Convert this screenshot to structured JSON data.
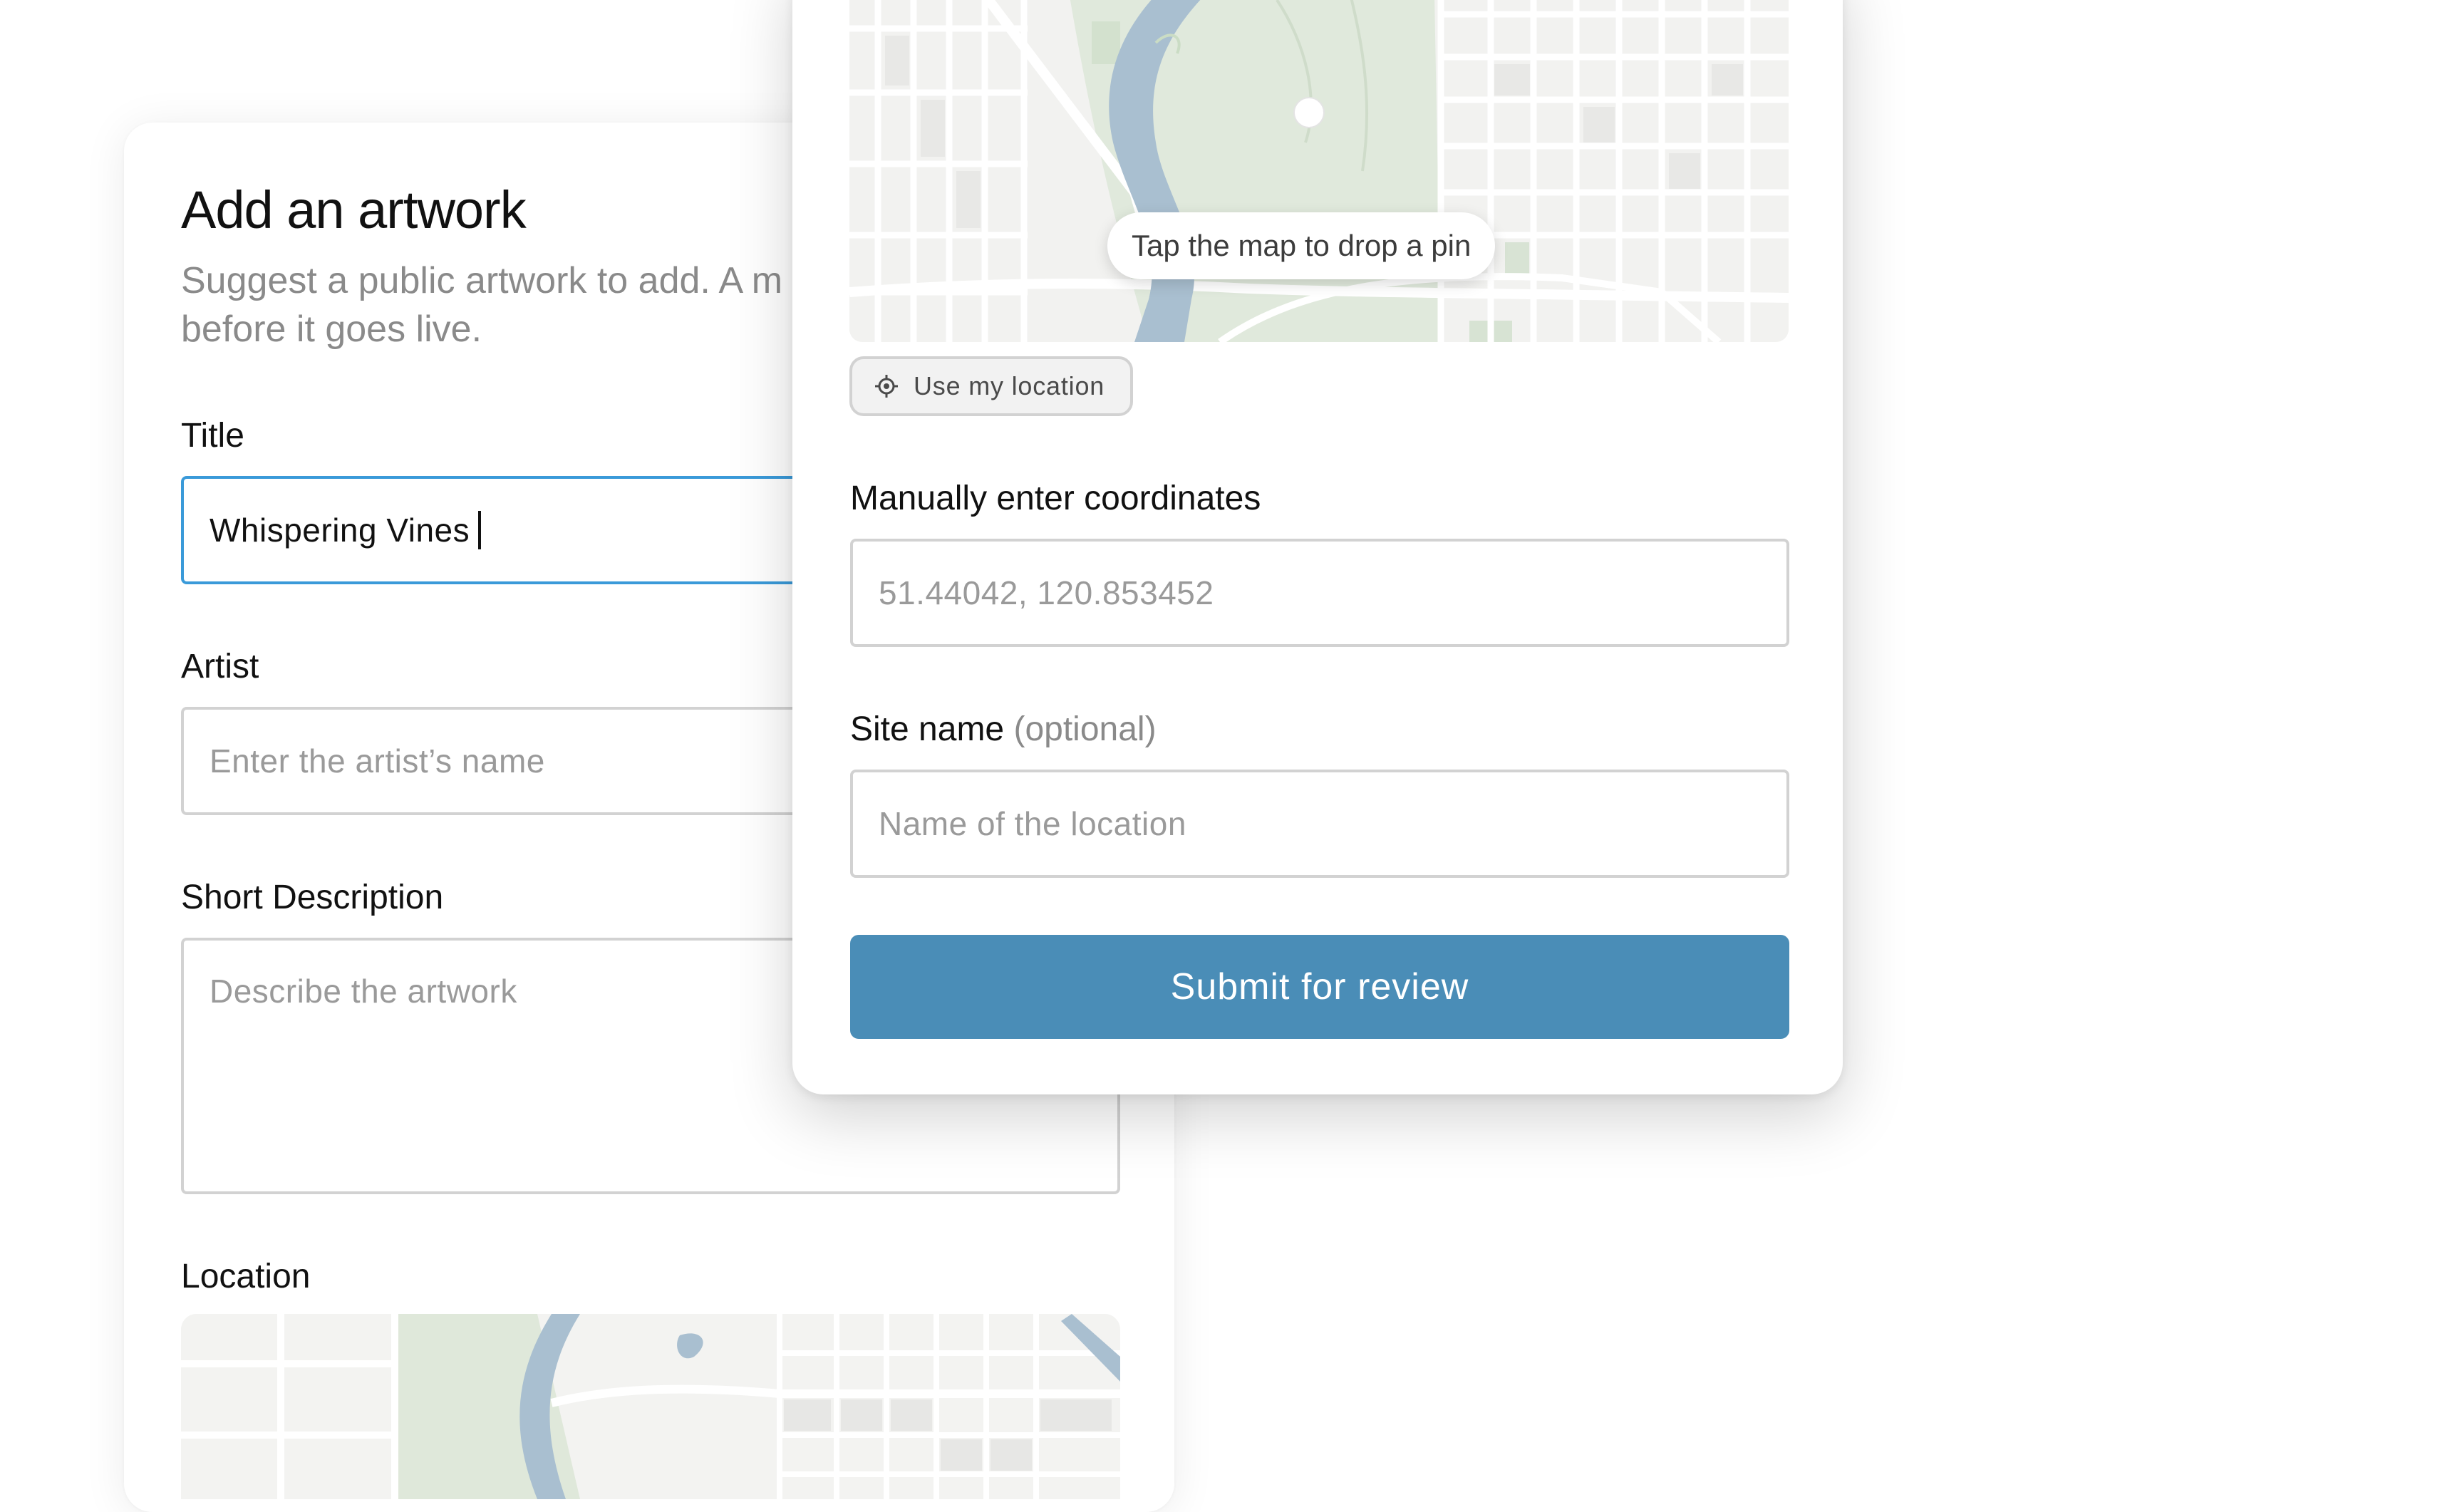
{
  "form": {
    "heading": "Add an artwork",
    "subtitle_line1": "Suggest a public artwork to add. A m",
    "subtitle_line2": "before it goes live.",
    "title_label": "Title",
    "title_value": "Whispering Vines",
    "artist_label": "Artist",
    "artist_placeholder": "Enter the artist’s name",
    "description_label": "Short Description",
    "description_placeholder": "Describe the artwork",
    "location_label": "Location"
  },
  "location_panel": {
    "map_hint": "Tap the map to drop a pin",
    "use_location_label": "Use my location",
    "coords_label": "Manually enter coordinates",
    "coords_placeholder": "51.44042, 120.853452",
    "site_name_label": "Site name",
    "site_name_optional": "(optional)",
    "site_name_placeholder": "Name of the location",
    "submit_label": "Submit for review"
  },
  "colors": {
    "accent_border": "#3a9ad9",
    "submit_bg": "#4a8db7",
    "map_water": "#a9bfd0",
    "map_park": "#dfe8da"
  }
}
